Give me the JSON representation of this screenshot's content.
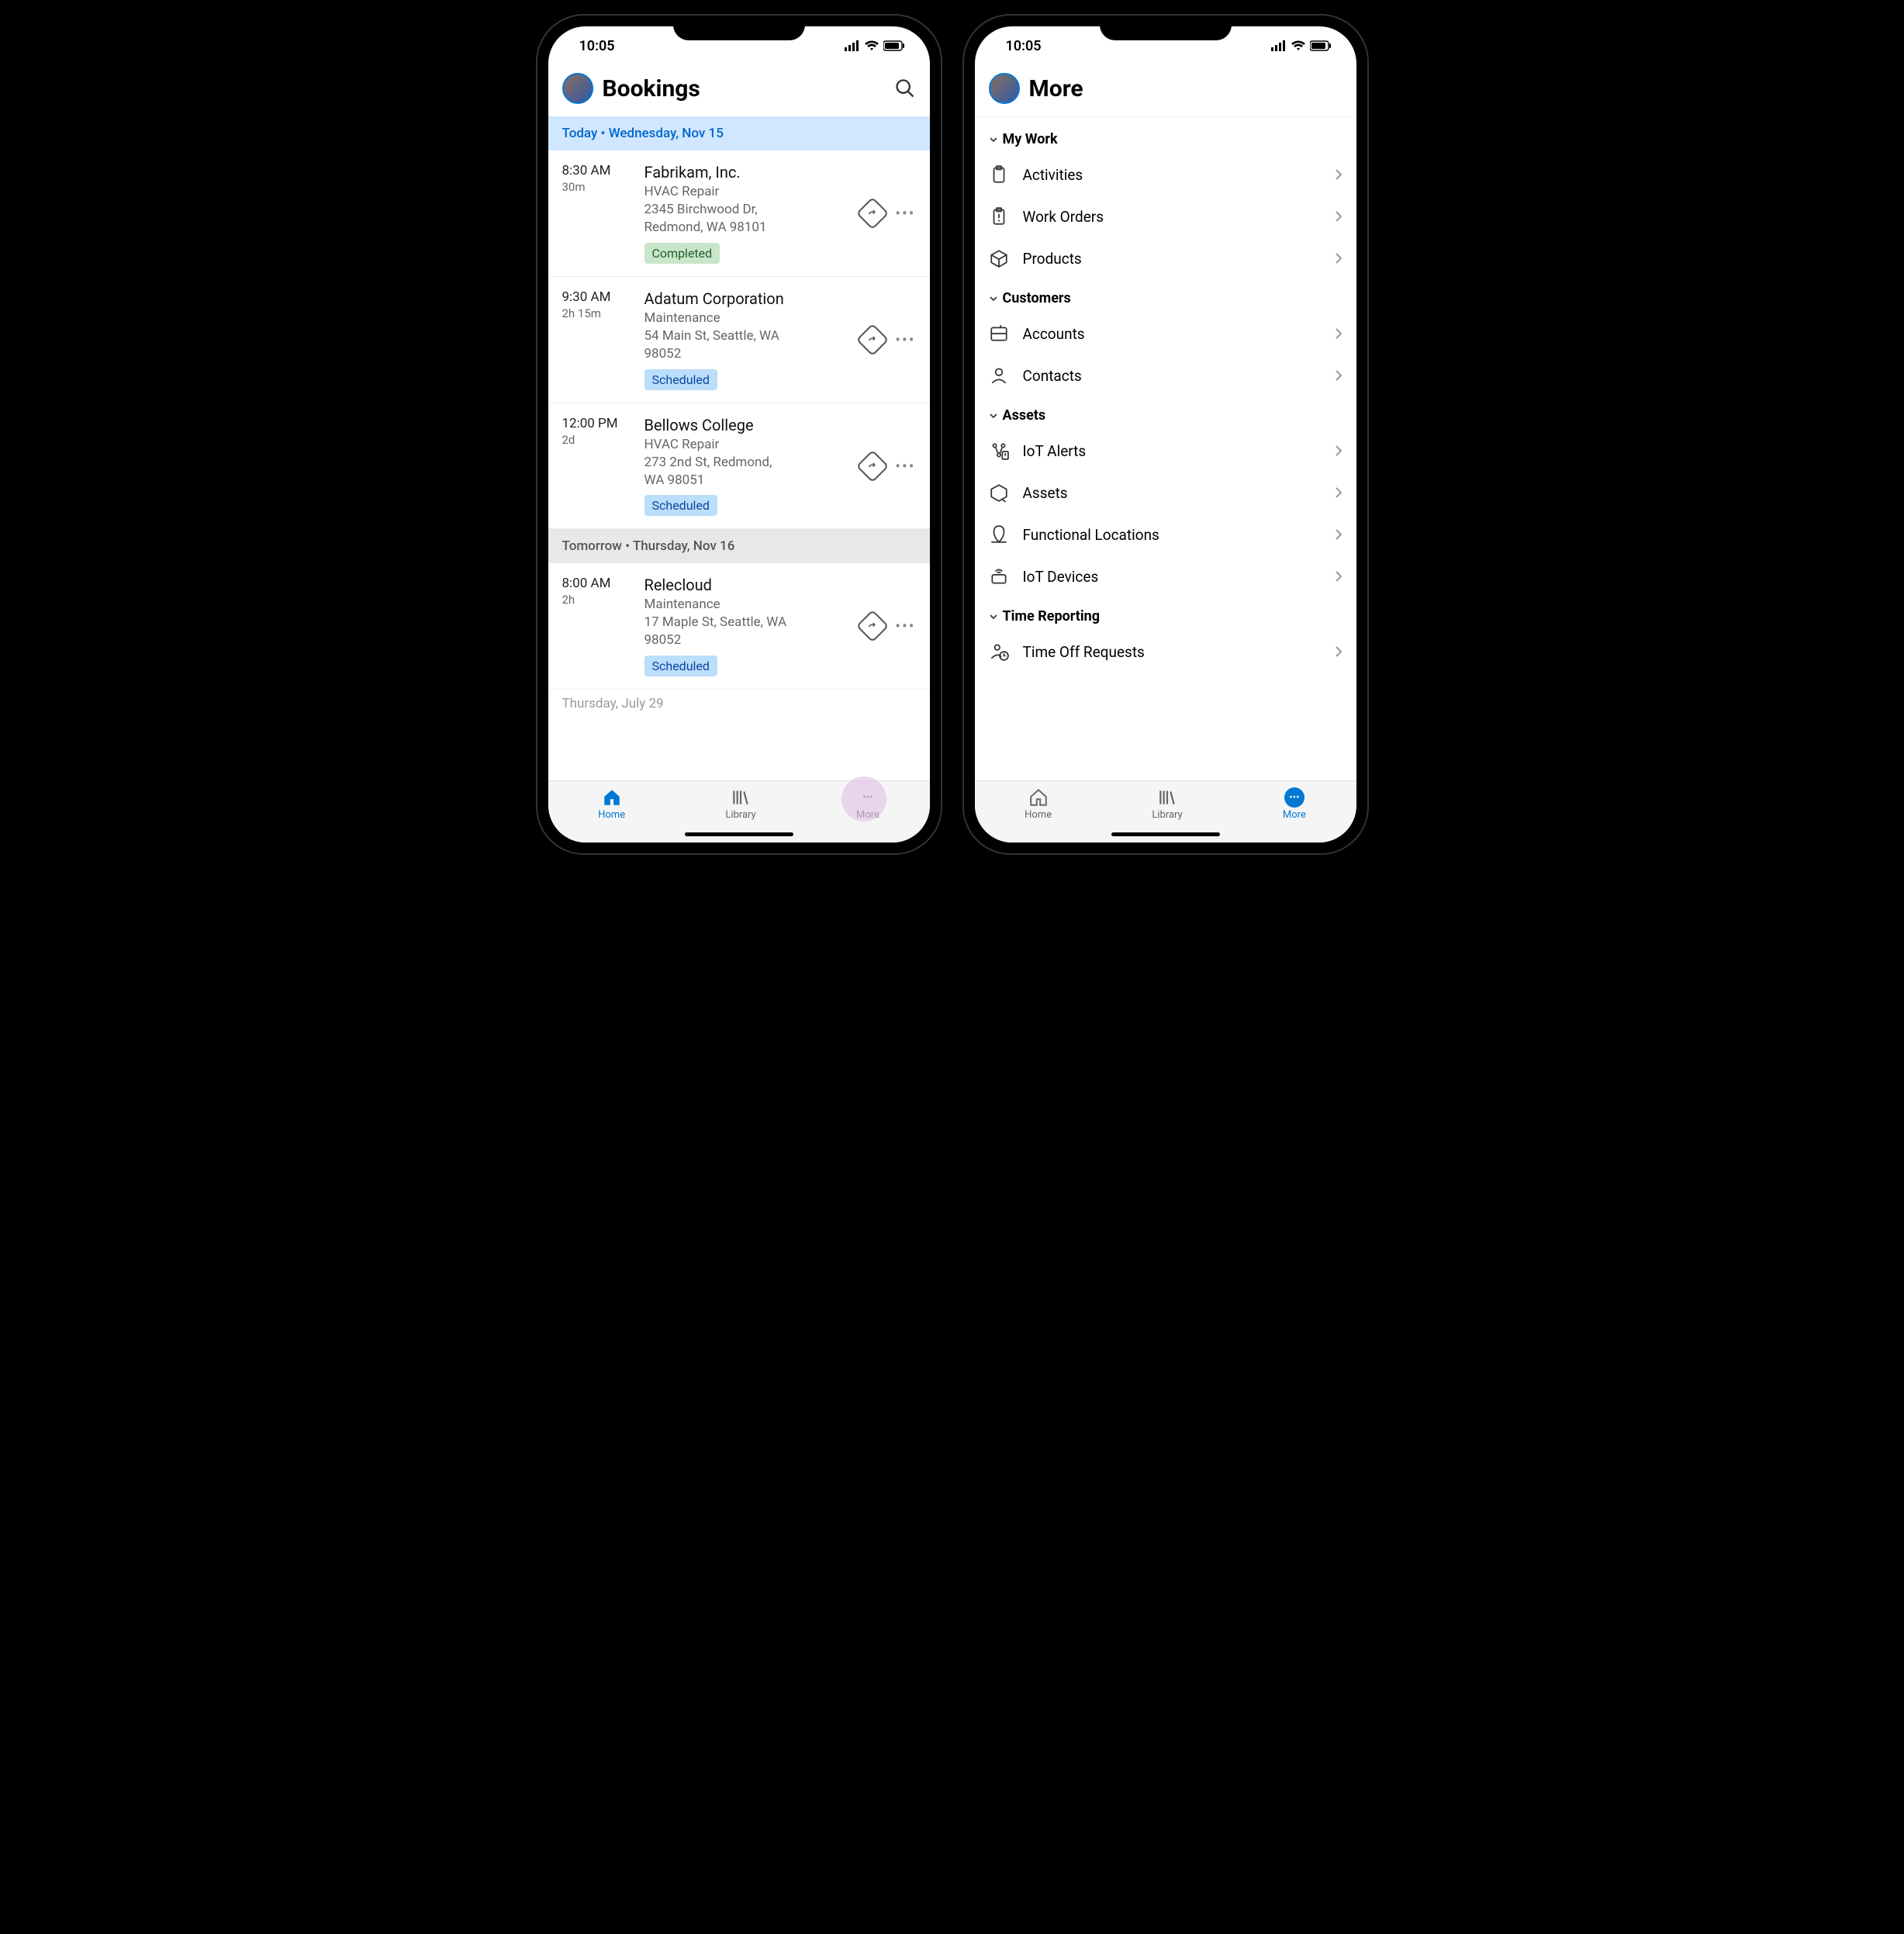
{
  "status": {
    "time": "10:05"
  },
  "left": {
    "title": "Bookings",
    "groups": [
      {
        "label": "Today • Wednesday, Nov 15",
        "style": "today",
        "bookings": [
          {
            "time": "8:30 AM",
            "dur": "30m",
            "name": "Fabrikam, Inc.",
            "type": "HVAC Repair",
            "addr1": "2345 Birchwood Dr,",
            "addr2": "Redmond, WA 98101",
            "status": "Completed",
            "statusClass": "completed"
          },
          {
            "time": "9:30 AM",
            "dur": "2h 15m",
            "name": "Adatum Corporation",
            "type": "Maintenance",
            "addr1": "54 Main St, Seattle, WA",
            "addr2": "98052",
            "status": "Scheduled",
            "statusClass": "scheduled"
          },
          {
            "time": "12:00 PM",
            "dur": "2d",
            "name": "Bellows College",
            "type": "HVAC Repair",
            "addr1": "273 2nd St, Redmond,",
            "addr2": "WA 98051",
            "status": "Scheduled",
            "statusClass": "scheduled"
          }
        ]
      },
      {
        "label": "Tomorrow • Thursday, Nov 16",
        "style": "secondary",
        "bookings": [
          {
            "time": "8:00 AM",
            "dur": "2h",
            "name": "Relecloud",
            "type": "Maintenance",
            "addr1": "17 Maple St, Seattle, WA",
            "addr2": "98052",
            "status": "Scheduled",
            "statusClass": "scheduled"
          }
        ]
      }
    ],
    "faded_date": "Thursday, July 29",
    "tabs": {
      "home": "Home",
      "library": "Library",
      "more": "More",
      "active": "home"
    }
  },
  "right": {
    "title": "More",
    "sections": [
      {
        "name": "My Work",
        "items": [
          {
            "icon": "clipboard",
            "label": "Activities"
          },
          {
            "icon": "clipboard-alert",
            "label": "Work Orders"
          },
          {
            "icon": "box",
            "label": "Products"
          }
        ]
      },
      {
        "name": "Customers",
        "items": [
          {
            "icon": "briefcase",
            "label": "Accounts"
          },
          {
            "icon": "person",
            "label": "Contacts"
          }
        ]
      },
      {
        "name": "Assets",
        "items": [
          {
            "icon": "iot-alert",
            "label": "IoT Alerts"
          },
          {
            "icon": "asset",
            "label": "Assets"
          },
          {
            "icon": "location",
            "label": "Functional Locations"
          },
          {
            "icon": "device",
            "label": "IoT Devices"
          }
        ]
      },
      {
        "name": "Time Reporting",
        "items": [
          {
            "icon": "person-clock",
            "label": "Time Off Requests"
          }
        ]
      }
    ],
    "tabs": {
      "home": "Home",
      "library": "Library",
      "more": "More",
      "active": "more"
    }
  }
}
